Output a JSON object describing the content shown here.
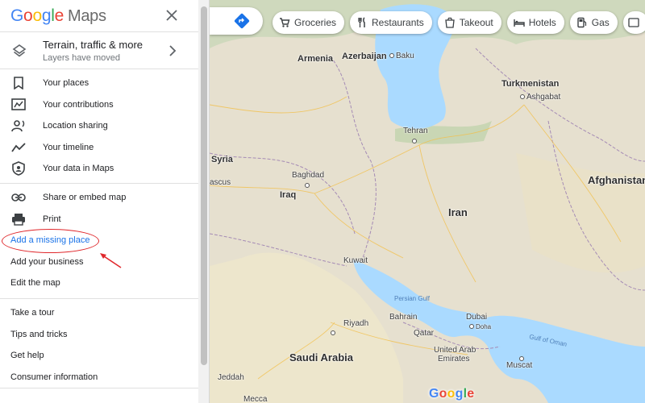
{
  "app": {
    "logo_google": "Google",
    "logo_maps": "Maps"
  },
  "layers": {
    "title": "Terrain, traffic & more",
    "subtitle": "Layers have moved"
  },
  "menu_section_1": [
    {
      "label": "Your places",
      "icon": "bookmark-icon"
    },
    {
      "label": "Your contributions",
      "icon": "contributions-icon"
    },
    {
      "label": "Location sharing",
      "icon": "location-sharing-icon"
    },
    {
      "label": "Your timeline",
      "icon": "timeline-icon"
    },
    {
      "label": "Your data in Maps",
      "icon": "shield-icon"
    }
  ],
  "menu_section_2": {
    "share": "Share or embed map",
    "print": "Print",
    "add_missing_place": "Add a missing place",
    "add_business": "Add your business",
    "edit_map": "Edit the map"
  },
  "menu_section_3": [
    "Take a tour",
    "Tips and tricks",
    "Get help",
    "Consumer information"
  ],
  "chips": [
    "Groceries",
    "Restaurants",
    "Takeout",
    "Hotels",
    "Gas"
  ],
  "map_labels": {
    "armenia": "Armenia",
    "azerbaijan": "Azerbaijan",
    "baku": "Baku",
    "turkmenistan": "Turkmenistan",
    "ashgabat": "Ashgabat",
    "tehran": "Tehran",
    "syria": "Syria",
    "damascus": "ascus",
    "baghdad": "Baghdad",
    "iraq": "Iraq",
    "afghanistan": "Afghanistan",
    "iran": "Iran",
    "kuwait": "Kuwait",
    "persian_gulf": "Persian Gulf",
    "bahrain": "Bahrain",
    "doha": "Doha",
    "qatar": "Qatar",
    "dubai": "Dubai",
    "riyadh": "Riyadh",
    "uae_1": "United Arab",
    "uae_2": "Emirates",
    "gulf_of_oman": "Gulf of Oman",
    "saudi_arabia": "Saudi Arabia",
    "muscat": "Muscat",
    "jeddah": "Jeddah",
    "mecca": "Mecca",
    "google": "Google"
  },
  "colors": {
    "accent_blue": "#1a73e8",
    "annotation_red": "#e0282c",
    "water": "#aadaff"
  }
}
